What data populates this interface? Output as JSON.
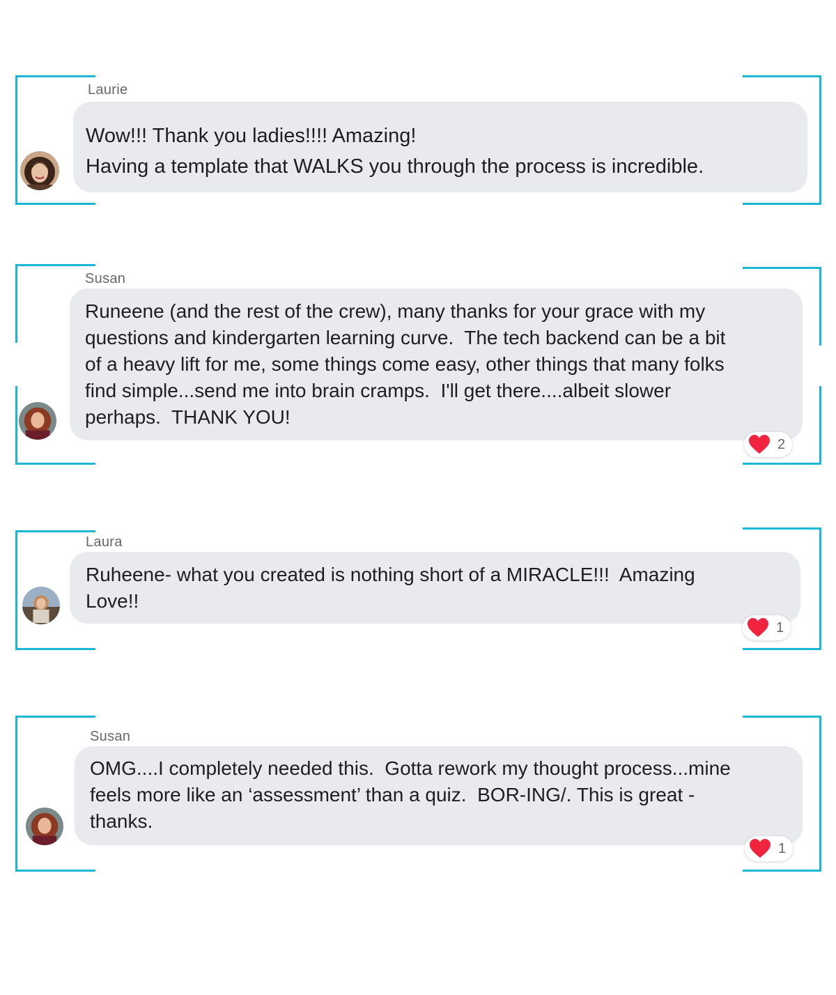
{
  "colors": {
    "bracket": "#1cb7d3",
    "bubble": "#e9eaee",
    "author": "#65676b",
    "heart": "#f0243e"
  },
  "comments": [
    {
      "author": "Laurie",
      "text": "Wow!!! Thank you ladies!!!! Amazing!\nHaving a template that WALKS you through the process is incredible.",
      "avatar_icon": "profile-photo-avatar"
    },
    {
      "author": "Susan",
      "text": "Runeene (and the rest of the crew), many thanks for your grace with my\nquestions and kindergarten learning curve.  The tech backend can be a bit\nof a heavy lift for me, some things come easy, other things that many folks\nfind simple...send me into brain cramps.  I'll get there....albeit slower\nperhaps.  THANK YOU!",
      "avatar_icon": "profile-photo-avatar",
      "reaction": {
        "icon": "heart-icon",
        "count": "2"
      }
    },
    {
      "author": "Laura",
      "text": "Ruheene- what you created is nothing short of a MIRACLE!!!  Amazing\nLove!!",
      "avatar_icon": "profile-photo-avatar",
      "reaction": {
        "icon": "heart-icon",
        "count": "1"
      }
    },
    {
      "author": "Susan",
      "text": "OMG....I completely needed this.  Gotta rework my thought process...mine\nfeels more like an ‘assessment’ than a quiz.  BOR-ING/. This is great -\nthanks.",
      "avatar_icon": "profile-photo-avatar",
      "reaction": {
        "icon": "heart-icon",
        "count": "1"
      }
    }
  ]
}
